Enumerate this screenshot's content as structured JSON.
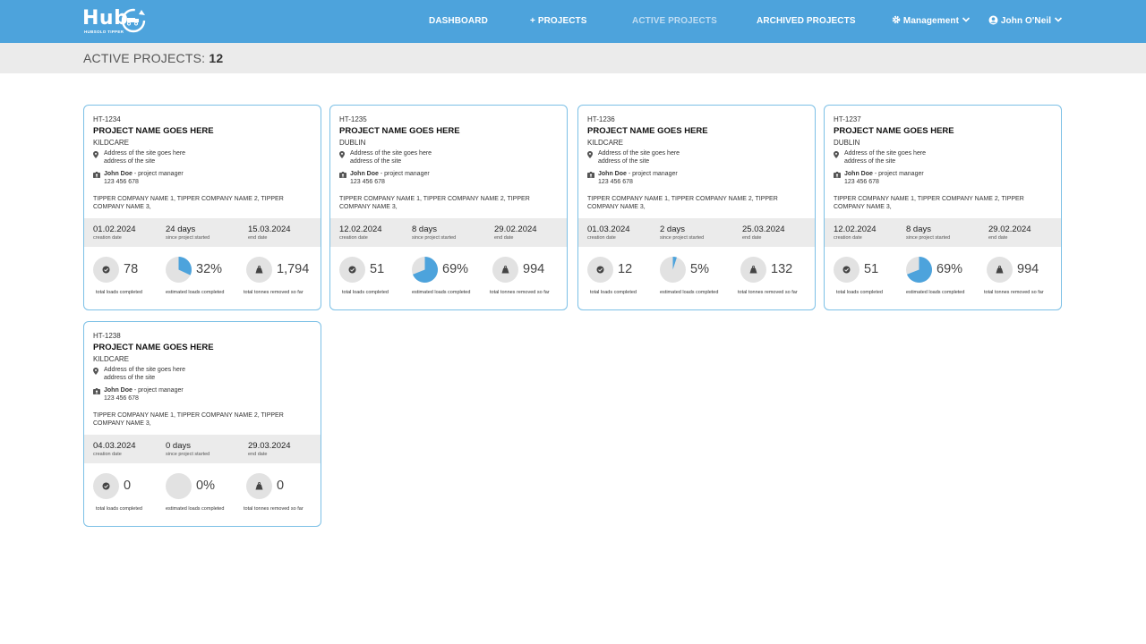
{
  "brand": {
    "name": "Hub",
    "tagline": "HUBSOLO TIPPER"
  },
  "nav": {
    "dashboard": "DASHBOARD",
    "projects": "+ PROJECTS",
    "active_projects": "ACTIVE PROJECTS",
    "archived_projects": "ARCHIVED PROJECTS",
    "management": "Management",
    "user": "John O'Neil"
  },
  "page": {
    "title_prefix": "ACTIVE PROJECTS:",
    "count": "12"
  },
  "colors": {
    "accent": "#4da3dc",
    "card_border": "#7cc0e6",
    "pie_fill": "#4da3dc",
    "pie_bg": "#e2e2e2"
  },
  "labels": {
    "creation_date": "creation date",
    "since_started": "since project started",
    "end_date": "end date",
    "total_loads": "total loads completed",
    "estimated_loads": "estimated loads completed",
    "total_tonnes": "total tonnes removed so far"
  },
  "projects": [
    {
      "id": "HT-1234",
      "name": "PROJECT NAME GOES HERE",
      "city": "KILDCARE",
      "address_line1": "Address of the site goes here",
      "address_line2": "address of the site",
      "manager_name": "John Doe",
      "manager_role": " - project manager",
      "phone": "123 456 678",
      "companies": "TIPPER COMPANY NAME 1, TIPPER COMPANY NAME 2, TIPPER COMPANY NAME 3,",
      "creation_date": "01.02.2024",
      "days": "24 days",
      "end_date": "15.03.2024",
      "loads": "78",
      "estimated_percent": 32,
      "estimated": "32%",
      "tonnes": "1,794"
    },
    {
      "id": "HT-1235",
      "name": "PROJECT NAME GOES HERE",
      "city": "DUBLIN",
      "address_line1": "Address of the site goes here",
      "address_line2": "address of the site",
      "manager_name": "John Doe",
      "manager_role": " - project manager",
      "phone": "123 456 678",
      "companies": "TIPPER COMPANY NAME 1, TIPPER COMPANY NAME 2, TIPPER COMPANY NAME 3,",
      "creation_date": "12.02.2024",
      "days": "8 days",
      "end_date": "29.02.2024",
      "loads": "51",
      "estimated_percent": 69,
      "estimated": "69%",
      "tonnes": "994"
    },
    {
      "id": "HT-1236",
      "name": "PROJECT NAME GOES HERE",
      "city": "KILDCARE",
      "address_line1": "Address of the site goes here",
      "address_line2": "address of the site",
      "manager_name": "John Doe",
      "manager_role": " - project manager",
      "phone": "123 456 678",
      "companies": "TIPPER COMPANY NAME 1, TIPPER COMPANY NAME 2, TIPPER COMPANY NAME 3,",
      "creation_date": "01.03.2024",
      "days": "2 days",
      "end_date": "25.03.2024",
      "loads": "12",
      "estimated_percent": 5,
      "estimated": "5%",
      "tonnes": "132"
    },
    {
      "id": "HT-1237",
      "name": "PROJECT NAME GOES HERE",
      "city": "DUBLIN",
      "address_line1": "Address of the site goes here",
      "address_line2": "address of the site",
      "manager_name": "John Doe",
      "manager_role": " - project manager",
      "phone": "123 456 678",
      "companies": "TIPPER COMPANY NAME 1, TIPPER COMPANY NAME 2, TIPPER COMPANY NAME 3,",
      "creation_date": "12.02.2024",
      "days": "8 days",
      "end_date": "29.02.2024",
      "loads": "51",
      "estimated_percent": 69,
      "estimated": "69%",
      "tonnes": "994"
    },
    {
      "id": "HT-1238",
      "name": "PROJECT NAME GOES HERE",
      "city": "KILDCARE",
      "address_line1": "Address of the site goes here",
      "address_line2": "address of the site",
      "manager_name": "John Doe",
      "manager_role": " - project manager",
      "phone": "123 456 678",
      "companies": "TIPPER COMPANY NAME 1, TIPPER COMPANY NAME 2, TIPPER COMPANY NAME 3,",
      "creation_date": "04.03.2024",
      "days": "0 days",
      "end_date": "29.03.2024",
      "loads": "0",
      "estimated_percent": 0,
      "estimated": "0%",
      "tonnes": "0"
    }
  ]
}
